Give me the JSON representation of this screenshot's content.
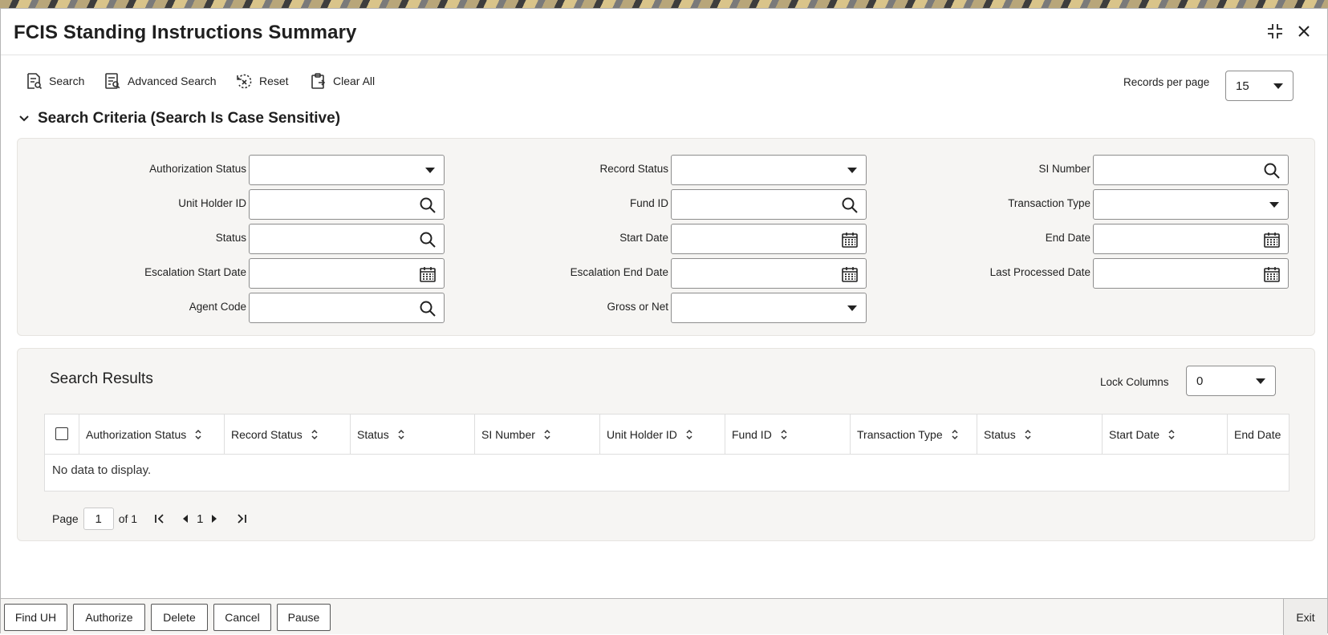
{
  "window": {
    "title": "FCIS Standing Instructions Summary"
  },
  "toolbar": {
    "search": "Search",
    "advanced_search": "Advanced Search",
    "reset": "Reset",
    "clear_all": "Clear All",
    "records_per_page_label": "Records per page",
    "records_per_page_value": "15"
  },
  "criteria": {
    "title": "Search Criteria (Search Is Case Sensitive)",
    "fields": {
      "authorization_status": "Authorization Status",
      "record_status": "Record Status",
      "si_number": "SI Number",
      "unit_holder_id": "Unit Holder ID",
      "fund_id": "Fund ID",
      "transaction_type": "Transaction Type",
      "status": "Status",
      "start_date": "Start Date",
      "end_date": "End Date",
      "escalation_start_date": "Escalation Start Date",
      "escalation_end_date": "Escalation End Date",
      "last_processed_date": "Last Processed Date",
      "agent_code": "Agent Code",
      "gross_or_net": "Gross or Net"
    }
  },
  "results": {
    "title": "Search Results",
    "lock_columns_label": "Lock Columns",
    "lock_columns_value": "0",
    "columns": [
      "Authorization Status",
      "Record Status",
      "Status",
      "SI Number",
      "Unit Holder ID",
      "Fund ID",
      "Transaction Type",
      "Status",
      "Start Date",
      "End Date"
    ],
    "empty_message": "No data to display.",
    "pager": {
      "page_label": "Page",
      "page_value": "1",
      "of_label": "of 1",
      "current": "1"
    }
  },
  "footer": {
    "buttons": [
      "Find UH",
      "Authorize",
      "Delete",
      "Cancel",
      "Pause"
    ],
    "exit": "Exit"
  }
}
